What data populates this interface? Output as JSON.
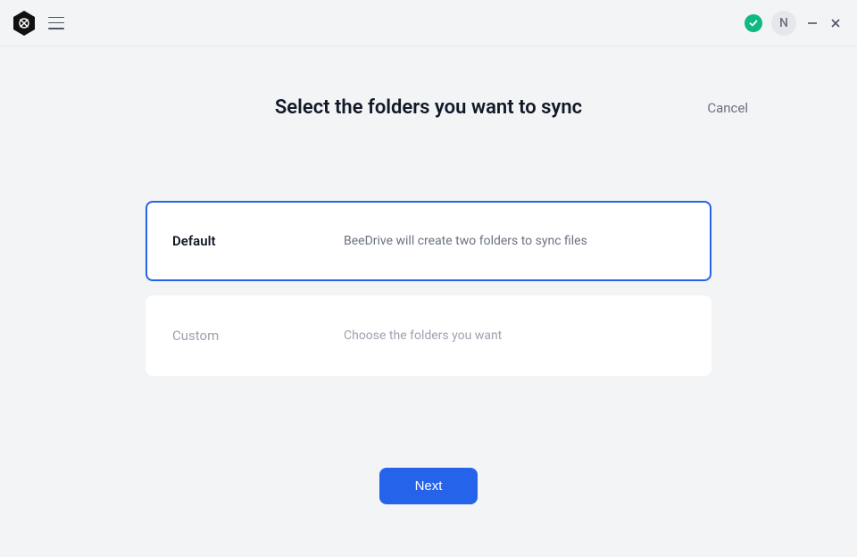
{
  "header": {
    "avatar_initial": "N"
  },
  "page": {
    "title": "Select the folders you want to sync",
    "cancel": "Cancel"
  },
  "options": {
    "default": {
      "label": "Default",
      "desc": "BeeDrive will create two folders to sync files"
    },
    "custom": {
      "label": "Custom",
      "desc": "Choose the folders you want"
    }
  },
  "footer": {
    "next": "Next"
  }
}
